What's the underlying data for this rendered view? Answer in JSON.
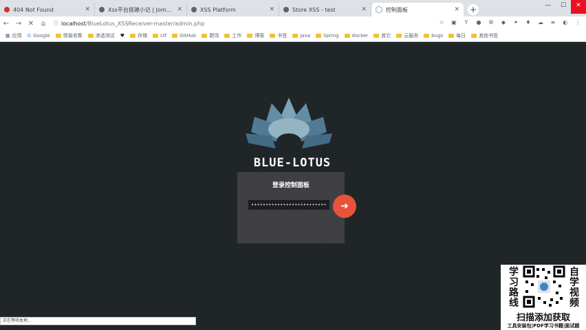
{
  "browser": {
    "tabs": [
      {
        "title": "404 Not Found",
        "favicon_color": "#d93025"
      },
      {
        "title": "Xss平台搭建小记 | Jomask's Blo",
        "favicon_color": "#5f6368"
      },
      {
        "title": "XSS Platform",
        "favicon_color": "#5f6368"
      },
      {
        "title": "Store XSS - test",
        "favicon_color": "#5f6368"
      },
      {
        "title": "控制面板",
        "favicon_color": "#9aa0a6"
      }
    ],
    "url_host": "localhost",
    "url_path": "/BlueLotus_XSSReceiver-master/admin.php",
    "bookmarks": [
      "应用",
      "Google",
      "情报收集",
      "渗透测试",
      "♥",
      "存储",
      "ctf",
      "GitHub",
      "靶场",
      "工作",
      "博客",
      "书签",
      "java",
      "Spring",
      "docker",
      "其它",
      "云服务",
      "bugs",
      "每日",
      "其他书签"
    ]
  },
  "app": {
    "brand": "BLUE-LOTUS",
    "panel_title": "登录控制面板",
    "password_value": "••••••••••••••••••••••••••••••••",
    "submit_icon": "arrow-right-icon",
    "accent": "#e8533a"
  },
  "status_text": "正在等待本地...",
  "promo": {
    "left_text": "学习路线",
    "right_text": "自学视频",
    "big_text": "扫描添加获取",
    "small_text": "工具安装包|PDF学习书籍|面试题"
  }
}
